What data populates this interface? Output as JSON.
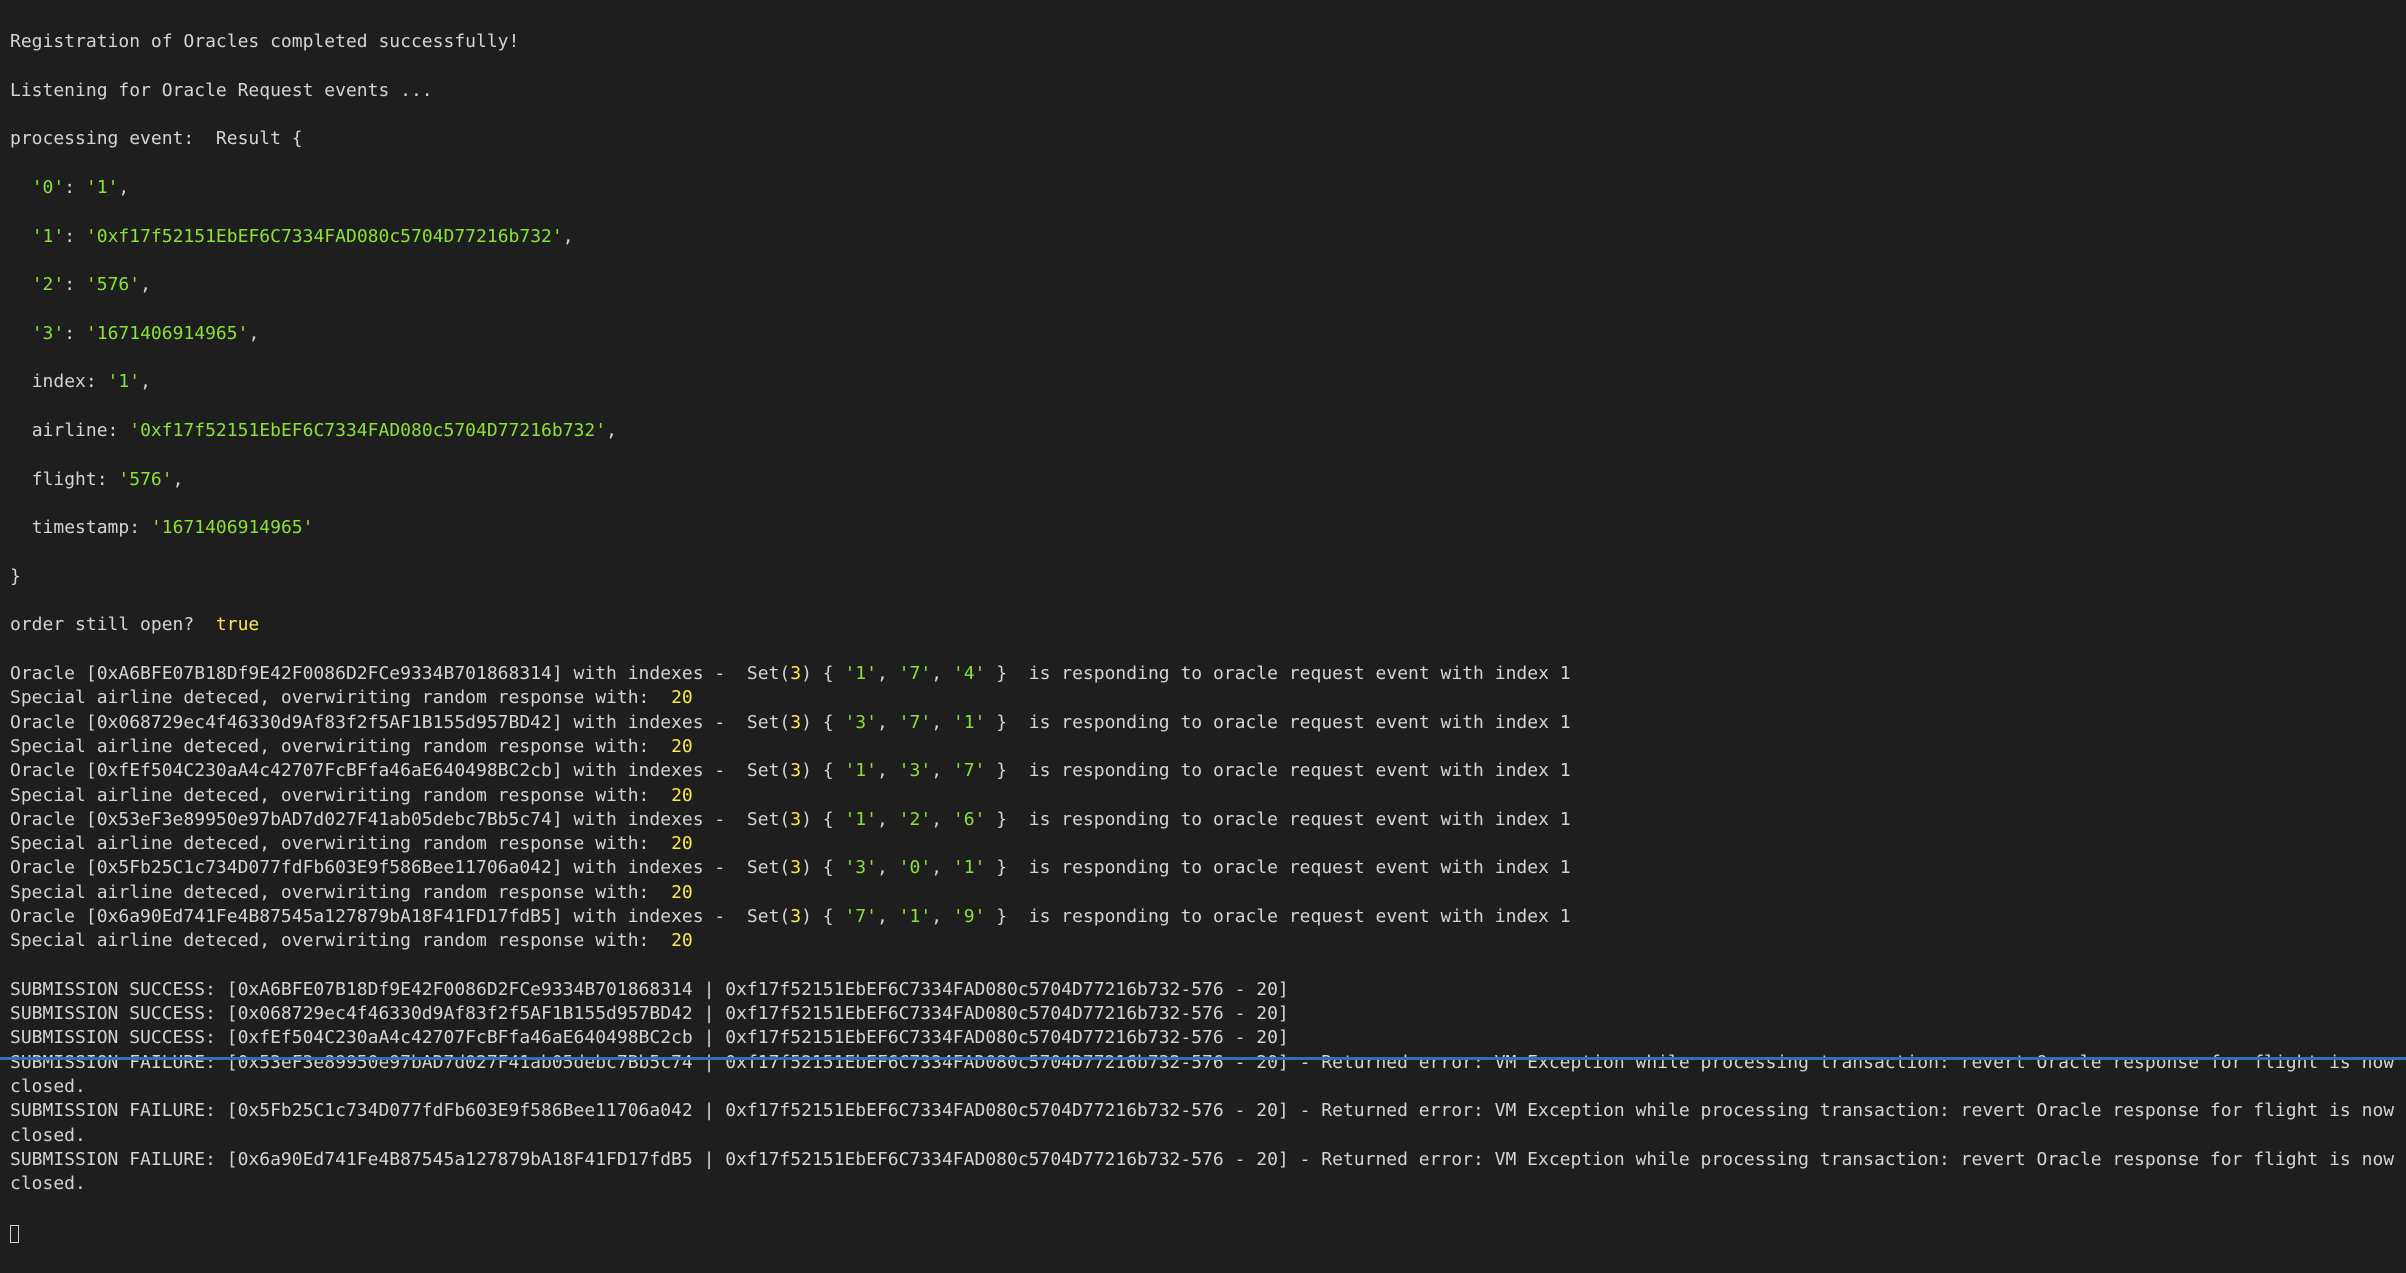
{
  "colors": {
    "bg": "#1e1e1e",
    "fg": "#d4d4d4",
    "green": "#8ae234",
    "yellow": "#fce94f",
    "blue_bar": "#2e6fb8"
  },
  "intro": {
    "line1": "Registration of Oracles completed successfully!",
    "line2": "Listening for Oracle Request events ...",
    "line3": "processing event:  Result {"
  },
  "result": {
    "0_key": "'0'",
    "0_colon": ": ",
    "0_val": "'1'",
    "0_comma": ",",
    "1_key": "'1'",
    "1_colon": ": ",
    "1_val": "'0xf17f52151EbEF6C7334FAD080c5704D77216b732'",
    "1_comma": ",",
    "2_key": "'2'",
    "2_colon": ": ",
    "2_val": "'576'",
    "2_comma": ",",
    "3_key": "'3'",
    "3_colon": ": ",
    "3_val": "'1671406914965'",
    "3_comma": ",",
    "index_label": "  index: ",
    "index_val": "'1'",
    "index_comma": ",",
    "airline_label": "  airline: ",
    "airline_val": "'0xf17f52151EbEF6C7334FAD080c5704D77216b732'",
    "airline_comma": ",",
    "flight_label": "  flight: ",
    "flight_val": "'576'",
    "flight_comma": ",",
    "ts_label": "  timestamp: ",
    "ts_val": "'1671406914965'",
    "close_brace": "}"
  },
  "order_line": {
    "prefix": "order still open?  ",
    "value": "true"
  },
  "oracles": [
    {
      "addr": "0xA6BFE07B18Df9E42F0086D2FCe9334B701868314",
      "pre": "Oracle [",
      "post_addr": "] with indexes -  Set(",
      "count": "3",
      "open": ") { ",
      "v1": "'1'",
      "c1": ", ",
      "v2": "'7'",
      "c2": ", ",
      "v3": "'4'",
      "close": " }  is responding to oracle request event with index 1",
      "special_pre": "Special airline deteced, overwiriting random response with:  ",
      "special_val": "20"
    },
    {
      "addr": "0x068729ec4f46330d9Af83f2f5AF1B155d957BD42",
      "pre": "Oracle [",
      "post_addr": "] with indexes -  Set(",
      "count": "3",
      "open": ") { ",
      "v1": "'3'",
      "c1": ", ",
      "v2": "'7'",
      "c2": ", ",
      "v3": "'1'",
      "close": " }  is responding to oracle request event with index 1",
      "special_pre": "Special airline deteced, overwiriting random response with:  ",
      "special_val": "20"
    },
    {
      "addr": "0xfEf504C230aA4c42707FcBFfa46aE640498BC2cb",
      "pre": "Oracle [",
      "post_addr": "] with indexes -  Set(",
      "count": "3",
      "open": ") { ",
      "v1": "'1'",
      "c1": ", ",
      "v2": "'3'",
      "c2": ", ",
      "v3": "'7'",
      "close": " }  is responding to oracle request event with index 1",
      "special_pre": "Special airline deteced, overwiriting random response with:  ",
      "special_val": "20"
    },
    {
      "addr": "0x53eF3e89950e97bAD7d027F41ab05debc7Bb5c74",
      "pre": "Oracle [",
      "post_addr": "] with indexes -  Set(",
      "count": "3",
      "open": ") { ",
      "v1": "'1'",
      "c1": ", ",
      "v2": "'2'",
      "c2": ", ",
      "v3": "'6'",
      "close": " }  is responding to oracle request event with index 1",
      "special_pre": "Special airline deteced, overwiriting random response with:  ",
      "special_val": "20"
    },
    {
      "addr": "0x5Fb25C1c734D077fdFb603E9f586Bee11706a042",
      "pre": "Oracle [",
      "post_addr": "] with indexes -  Set(",
      "count": "3",
      "open": ") { ",
      "v1": "'3'",
      "c1": ", ",
      "v2": "'0'",
      "c2": ", ",
      "v3": "'1'",
      "close": " }  is responding to oracle request event with index 1",
      "special_pre": "Special airline deteced, overwiriting random response with:  ",
      "special_val": "20"
    },
    {
      "addr": "0x6a90Ed741Fe4B87545a127879bA18F41FD17fdB5",
      "pre": "Oracle [",
      "post_addr": "] with indexes -  Set(",
      "count": "3",
      "open": ") { ",
      "v1": "'7'",
      "c1": ", ",
      "v2": "'1'",
      "c2": ", ",
      "v3": "'9'",
      "close": " }  is responding to oracle request event with index 1",
      "special_pre": "Special airline deteced, overwiriting random response with:  ",
      "special_val": "20"
    }
  ],
  "submissions": [
    {
      "text": "SUBMISSION SUCCESS: [0xA6BFE07B18Df9E42F0086D2FCe9334B701868314 | 0xf17f52151EbEF6C7334FAD080c5704D77216b732-576 - 20]"
    },
    {
      "text": "SUBMISSION SUCCESS: [0x068729ec4f46330d9Af83f2f5AF1B155d957BD42 | 0xf17f52151EbEF6C7334FAD080c5704D77216b732-576 - 20]"
    },
    {
      "text": "SUBMISSION SUCCESS: [0xfEf504C230aA4c42707FcBFfa46aE640498BC2cb | 0xf17f52151EbEF6C7334FAD080c5704D77216b732-576 - 20]"
    },
    {
      "text": "SUBMISSION FAILURE: [0x53eF3e89950e97bAD7d027F41ab05debc7Bb5c74 | 0xf17f52151EbEF6C7334FAD080c5704D77216b732-576 - 20] - Returned error: VM Exception while processing transaction: revert Oracle response for flight is now closed."
    },
    {
      "text": "SUBMISSION FAILURE: [0x5Fb25C1c734D077fdFb603E9f586Bee11706a042 | 0xf17f52151EbEF6C7334FAD080c5704D77216b732-576 - 20] - Returned error: VM Exception while processing transaction: revert Oracle response for flight is now closed."
    },
    {
      "text": "SUBMISSION FAILURE: [0x6a90Ed741Fe4B87545a127879bA18F41FD17fdB5 | 0xf17f52151EbEF6C7334FAD080c5704D77216b732-576 - 20] - Returned error: VM Exception while processing transaction: revert Oracle response for flight is now closed."
    }
  ]
}
